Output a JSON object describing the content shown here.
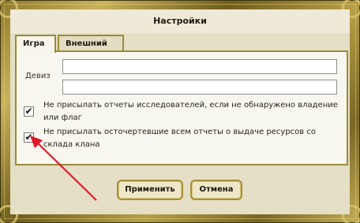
{
  "window": {
    "title": "Настройки"
  },
  "tabs": [
    {
      "label": "Игра",
      "active": true
    },
    {
      "label": "Внешний вид",
      "active": false
    }
  ],
  "form": {
    "motto_label": "Девиз",
    "motto_line1": "",
    "motto_line2": ""
  },
  "options": [
    {
      "label": "Не присылать отчеты исследователей, если не обнаружено владение или флаг",
      "checked": true,
      "mark": "✔"
    },
    {
      "label": "Не присылать осточертевшие всем отчеты о выдаче ресурсов со склада клана",
      "checked": true,
      "mark": "✔"
    }
  ],
  "buttons": {
    "apply": "Применить",
    "cancel": "Отмена"
  },
  "colors": {
    "frame_gold": "#b79f47",
    "panel_bg": "#f8f7ef",
    "body_bg": "#e5dfc6",
    "arrow_red": "#e0182b"
  }
}
